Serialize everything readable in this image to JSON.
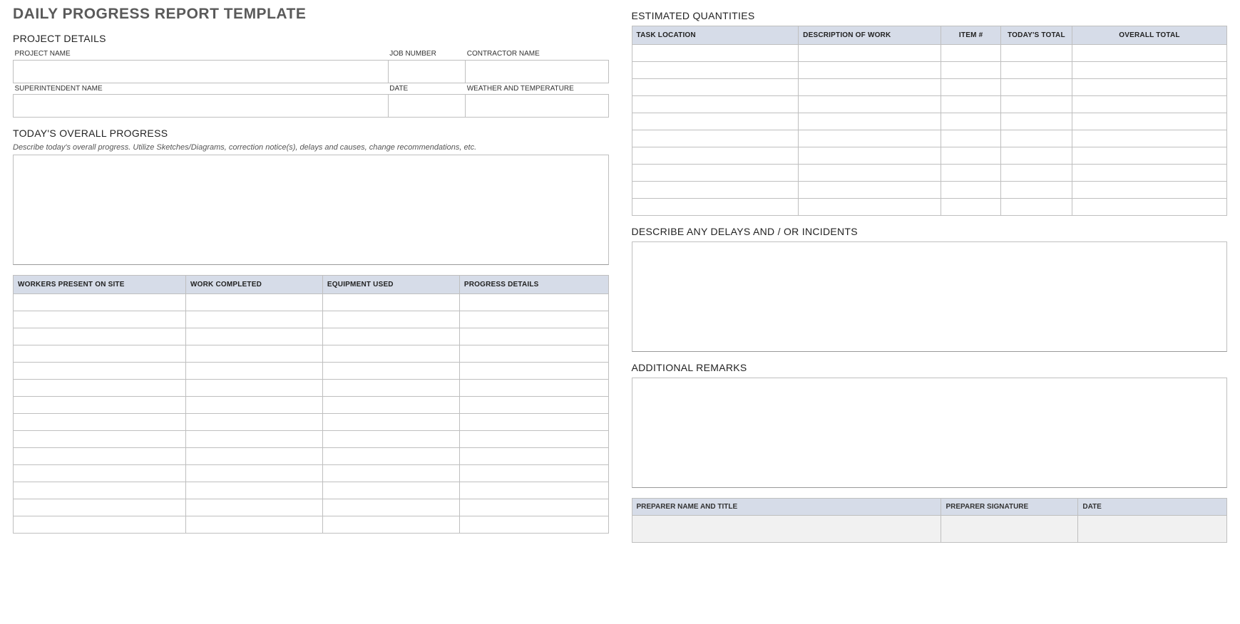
{
  "title": "DAILY PROGRESS REPORT TEMPLATE",
  "left": {
    "project_details_heading": "PROJECT DETAILS",
    "labels": {
      "project_name": "PROJECT NAME",
      "job_number": "JOB NUMBER",
      "contractor_name": "CONTRACTOR NAME",
      "superintendent_name": "SUPERINTENDENT NAME",
      "date": "DATE",
      "weather": "WEATHER AND TEMPERATURE"
    },
    "fields": {
      "project_name": "",
      "job_number": "",
      "contractor_name": "",
      "superintendent_name": "",
      "date": "",
      "weather": ""
    },
    "progress_heading": "TODAY'S OVERALL PROGRESS",
    "progress_hint": "Describe today's overall progress.  Utilize Sketches/Diagrams, correction notice(s), delays and causes, change recommendations, etc.",
    "progress_text": "",
    "work_table_headers": [
      "WORKERS PRESENT ON SITE",
      "WORK COMPLETED",
      "EQUIPMENT USED",
      "PROGRESS DETAILS"
    ],
    "work_rows": [
      [
        "",
        "",
        "",
        ""
      ],
      [
        "",
        "",
        "",
        ""
      ],
      [
        "",
        "",
        "",
        ""
      ],
      [
        "",
        "",
        "",
        ""
      ],
      [
        "",
        "",
        "",
        ""
      ],
      [
        "",
        "",
        "",
        ""
      ],
      [
        "",
        "",
        "",
        ""
      ],
      [
        "",
        "",
        "",
        ""
      ],
      [
        "",
        "",
        "",
        ""
      ],
      [
        "",
        "",
        "",
        ""
      ],
      [
        "",
        "",
        "",
        ""
      ],
      [
        "",
        "",
        "",
        ""
      ],
      [
        "",
        "",
        "",
        ""
      ],
      [
        "",
        "",
        "",
        ""
      ]
    ]
  },
  "right": {
    "quantities_heading": "ESTIMATED QUANTITIES",
    "quantities_headers": [
      "TASK LOCATION",
      "DESCRIPTION OF WORK",
      "ITEM #",
      "TODAY'S TOTAL",
      "OVERALL TOTAL"
    ],
    "quantities_rows": [
      [
        "",
        "",
        "",
        "",
        ""
      ],
      [
        "",
        "",
        "",
        "",
        ""
      ],
      [
        "",
        "",
        "",
        "",
        ""
      ],
      [
        "",
        "",
        "",
        "",
        ""
      ],
      [
        "",
        "",
        "",
        "",
        ""
      ],
      [
        "",
        "",
        "",
        "",
        ""
      ],
      [
        "",
        "",
        "",
        "",
        ""
      ],
      [
        "",
        "",
        "",
        "",
        ""
      ],
      [
        "",
        "",
        "",
        "",
        ""
      ],
      [
        "",
        "",
        "",
        "",
        ""
      ]
    ],
    "delays_heading": "DESCRIBE ANY DELAYS AND / OR INCIDENTS",
    "delays_text": "",
    "remarks_heading": "ADDITIONAL REMARKS",
    "remarks_text": "",
    "sig_headers": [
      "PREPARER NAME AND TITLE",
      "PREPARER SIGNATURE",
      "DATE"
    ],
    "sig_fields": [
      "",
      "",
      ""
    ]
  }
}
